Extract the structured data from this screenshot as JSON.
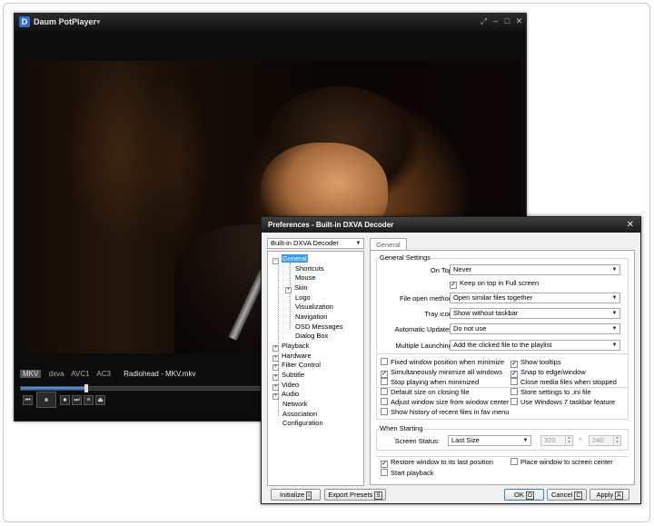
{
  "player": {
    "logo": "D",
    "title": "Daum PotPlayer",
    "title_arrow": "▾",
    "controls": [
      "⤢",
      "–",
      "□",
      "✕"
    ],
    "info": {
      "container": "MKV",
      "decoder": "dxva",
      "video_codec": "AVC1",
      "audio_codec": "AC3",
      "file": "Radiohead - MKV.mkv"
    },
    "progress": 0.13,
    "buttons": [
      "⏮",
      "⏸",
      "⏹",
      "⏭",
      "≡",
      "⏏"
    ]
  },
  "dialog": {
    "title": "Preferences - Built-in DXVA Decoder",
    "close": "✕",
    "category_combo": "Built-in DXVA Decoder",
    "tab": "General",
    "tree": {
      "general": "General",
      "shortcuts": "Shortcuts",
      "mouse": "Mouse",
      "skin": "Skin",
      "logo": "Logo",
      "visualization": "Visualization",
      "navigation": "Navigation",
      "osd": "OSD Messages",
      "dialog_box": "Dialog Box",
      "playback": "Playback",
      "hardware": "Hardware",
      "filter_control": "Filter Control",
      "subtitle": "Subtitle",
      "video": "Video",
      "audio": "Audio",
      "network": "Network",
      "association": "Association",
      "configuration": "Configuration"
    },
    "general_settings": {
      "title": "General Settings",
      "on_top_label": "On Top:",
      "on_top_value": "Never",
      "keep_on_top_full": "Keep on top in Full screen",
      "file_open_label": "File open method:",
      "file_open_value": "Open similar files together",
      "tray_label": "Tray icon:",
      "tray_value": "Show without taskbar",
      "updates_label": "Automatic Updates:",
      "updates_value": "Do not use",
      "multi_label": "Multiple Launching:",
      "multi_value": "Add the clicked file to the playlist"
    },
    "checkboxes_left": [
      {
        "label": "Fixed window position when minimize",
        "checked": false
      },
      {
        "label": "Simultaneously minimize all windows",
        "checked": true
      },
      {
        "label": "Stop playing when minimized",
        "checked": false
      },
      {
        "label": "Default size on closing file",
        "checked": false
      },
      {
        "label": "Adjust window size from window center",
        "checked": false
      },
      {
        "label": "Show history of recent files in fav menu",
        "checked": false
      }
    ],
    "checkboxes_right": [
      {
        "label": "Show tooltips",
        "checked": true
      },
      {
        "label": "Snap to edge/window",
        "checked": true
      },
      {
        "label": "Close media files when stopped",
        "checked": false
      },
      {
        "label": "Store settings to .ini file",
        "checked": false
      },
      {
        "label": "Use Windows 7 taskbar feature",
        "checked": false
      }
    ],
    "when_starting": {
      "title": "When Starting",
      "screen_status_label": "Screen Status:",
      "screen_status_value": "Last Size",
      "width": "320",
      "times": "×",
      "height": "240",
      "restore": "Restore window to its last position",
      "restore_checked": true,
      "center": "Place window to screen center",
      "center_checked": false,
      "start_playback": "Start playback",
      "start_checked": false
    },
    "buttons": {
      "initialize": "Initialize",
      "initialize_key": "I",
      "export": "Export Presets",
      "export_key": "S",
      "ok": "OK",
      "ok_key": "O",
      "cancel": "Cancel",
      "cancel_key": "C",
      "apply": "Apply",
      "apply_key": "A"
    }
  }
}
